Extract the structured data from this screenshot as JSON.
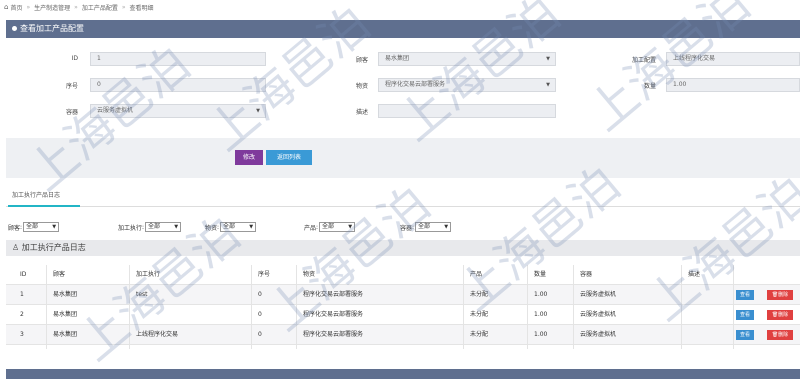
{
  "breadcrumb": {
    "items": [
      "首页",
      "生产制造管理",
      "加工产品配置",
      "查看明细"
    ]
  },
  "panel": {
    "title": "查看加工产品配置"
  },
  "form": {
    "id_label": "ID",
    "id_value": "1",
    "seq_label": "序号",
    "seq_value": "0",
    "container_label": "容器",
    "container_value": "云服务虚拟机",
    "customer_label": "顾客",
    "customer_value": "易水集团",
    "product_label": "物资",
    "product_value": "程序化交易云部署服务",
    "desc_label": "描述",
    "desc_value": "",
    "config_label": "加工配置",
    "config_value": "上线程序化交易",
    "qty_label": "数量",
    "qty_value": "1.00"
  },
  "buttons": {
    "modify": "修改",
    "back": "返回列表"
  },
  "tab": {
    "label": "加工执行产品日志"
  },
  "filters": [
    {
      "label": "顾客",
      "value": "全部"
    },
    {
      "label": "加工执行",
      "value": "全部"
    },
    {
      "label": "物资",
      "value": "全部"
    },
    {
      "label": "产品",
      "value": "全部"
    },
    {
      "label": "容器",
      "value": "全部"
    }
  ],
  "section": {
    "title": "加工执行产品日志"
  },
  "table": {
    "headers": [
      "ID",
      "顾客",
      "加工执行",
      "序号",
      "物资",
      "产品",
      "数量",
      "容器",
      "描述",
      ""
    ],
    "rows": [
      {
        "id": "1",
        "customer": "易水集团",
        "exec": "test",
        "seq": "0",
        "material": "程序化交易云部署服务",
        "product": "未分配",
        "qty": "1.00",
        "container": "云服务虚拟机",
        "desc": "",
        "view": "查看",
        "del": "删除"
      },
      {
        "id": "2",
        "customer": "易水集团",
        "exec": "",
        "seq": "0",
        "material": "程序化交易云部署服务",
        "product": "未分配",
        "qty": "1.00",
        "container": "云服务虚拟机",
        "desc": "",
        "view": "查看",
        "del": "删除"
      },
      {
        "id": "3",
        "customer": "易水集团",
        "exec": "上线程序化交易",
        "seq": "0",
        "material": "程序化交易云部署服务",
        "product": "未分配",
        "qty": "1.00",
        "container": "云服务虚拟机",
        "desc": "",
        "view": "查看",
        "del": "删除"
      }
    ]
  },
  "watermark": {
    "text": "上海邑泊"
  },
  "colors": {
    "header_bar": "#5f6f8f",
    "modify_btn": "#7f3a9c",
    "back_btn": "#3a9ad6",
    "view_btn": "#3a8fd0",
    "delete_btn": "#e04040",
    "tab_accent": "#23b5c6"
  }
}
